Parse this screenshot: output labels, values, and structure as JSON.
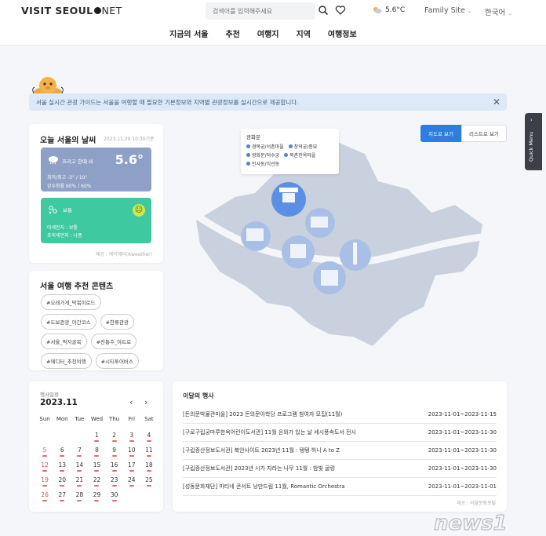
{
  "header": {
    "logo_main": "VISIT SEOUL",
    "logo_net": "NET",
    "search_placeholder": "검색어를 입력해주세요",
    "weather_temp": "5.6°C",
    "family_site": "Family Site",
    "language": "한국어",
    "nav": [
      "지금의 서울",
      "추천",
      "여행지",
      "지역",
      "여행정보"
    ]
  },
  "notice": {
    "text": "서울 실시간 관광 가이드는 서울을 여행할 때 필요한 기본정보와 지역별 관광정보를 실시간으로 제공합니다."
  },
  "weather": {
    "title": "오늘 서울의 날씨",
    "timestamp": "2023.11.29 10:30기준",
    "condition": "흐리고 한때 비",
    "temperature": "5.6°",
    "minmax": "최저/최고  -3° / 10°",
    "rain": "강수확률  60% / 60%",
    "air_label": "보통",
    "pm10": "미세먼지  :  보통",
    "pm25": "초미세먼지  :  나쁨",
    "source": "제공 : 케이웨더(Kweather)",
    "colors": {
      "weather_box": "#8fa0c7",
      "air_box": "#3ec9a0"
    }
  },
  "recommend": {
    "title": "서울 여행 추천 콘텐츠",
    "tags": [
      "#오래가게_막볶이로드",
      "#도보관광_야간코스",
      "#한류관광",
      "#서울_먹자골목",
      "#전통주_야트로",
      "#에디터_추천여행",
      "#시티투어버스"
    ]
  },
  "calendar": {
    "label": "행사일정",
    "month": "2023.11",
    "weekdays": [
      "Sun",
      "Mon",
      "Tue",
      "Wed",
      "Thu",
      "Fri",
      "Sat"
    ],
    "days": [
      [
        "",
        "",
        "",
        "1",
        "2",
        "3",
        "4"
      ],
      [
        "5",
        "6",
        "7",
        "8",
        "9",
        "10",
        "11"
      ],
      [
        "12",
        "13",
        "14",
        "15",
        "16",
        "17",
        "18"
      ],
      [
        "19",
        "20",
        "21",
        "22",
        "23",
        "24",
        "25"
      ],
      [
        "26",
        "27",
        "28",
        "29",
        "30",
        "",
        ""
      ]
    ]
  },
  "map": {
    "view_map": "지도로 보기",
    "view_list": "리스트로 보기",
    "legend_title": "광화문",
    "legend_items": [
      "경복궁/서촌마을",
      "창덕궁/종묘",
      "광화문/덕수궁",
      "북촌한옥마을",
      "인사동/익선동"
    ]
  },
  "events": {
    "title": "이달의 행사",
    "items": [
      {
        "title": "[돈의문박물관마을] 2023 돈의문아학당 프로그램 참여자 모집(11월)",
        "date": "2023-11-01~2023-11-15"
      },
      {
        "title": "[구로구립궁마루한옥어린이도서관] 11월 온와가 있는 날 세시풍속도서 전시",
        "date": "2023-11-01~2023-11-30"
      },
      {
        "title": "[구립증산정보도서관] 북안사이트 2023년 11월 : 탱탱 허니 A to Z",
        "date": "2023-11-01~2023-11-30"
      },
      {
        "title": "[구립증산정보도서관] 2023년 시가 자라는 나무 11월 : 밤빛 굴렁",
        "date": "2023-11-01~2023-11-30"
      },
      {
        "title": "[성동문화재단] 마티네 콘서트 낭만드림 11월, Romantic Orchestra",
        "date": "2023-11-01~2023-11-01"
      }
    ],
    "source": "제공 : 서울문화포털"
  },
  "quick_menu": "Quick Menu",
  "watermark": "news1"
}
